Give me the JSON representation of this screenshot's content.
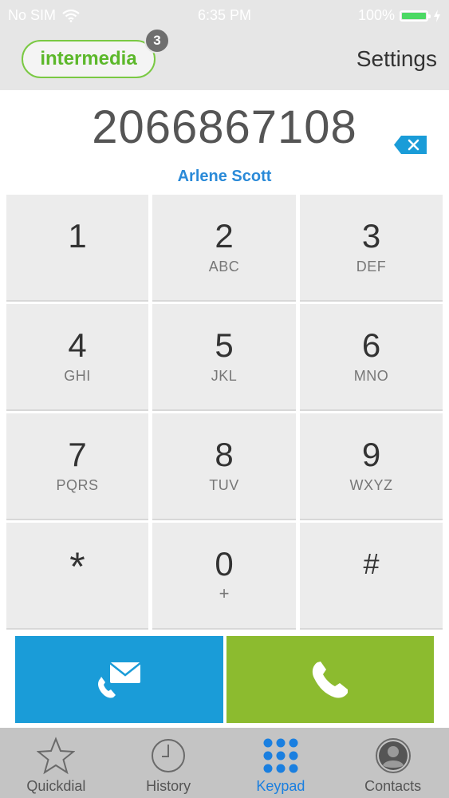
{
  "status": {
    "carrier": "No SIM",
    "time": "6:35 PM",
    "battery": "100%"
  },
  "header": {
    "logo": "intermedia",
    "badge_count": "3",
    "settings_label": "Settings"
  },
  "dialer": {
    "number": "2066867108",
    "contact_name": "Arlene Scott"
  },
  "keys": [
    {
      "digit": "1",
      "letters": ""
    },
    {
      "digit": "2",
      "letters": "ABC"
    },
    {
      "digit": "3",
      "letters": "DEF"
    },
    {
      "digit": "4",
      "letters": "GHI"
    },
    {
      "digit": "5",
      "letters": "JKL"
    },
    {
      "digit": "6",
      "letters": "MNO"
    },
    {
      "digit": "7",
      "letters": "PQRS"
    },
    {
      "digit": "8",
      "letters": "TUV"
    },
    {
      "digit": "9",
      "letters": "WXYZ"
    },
    {
      "digit": "*",
      "letters": ""
    },
    {
      "digit": "0",
      "letters": "+"
    },
    {
      "digit": "#",
      "letters": ""
    }
  ],
  "tabs": [
    {
      "label": "Quickdial",
      "icon": "star-icon"
    },
    {
      "label": "History",
      "icon": "clock-icon"
    },
    {
      "label": "Keypad",
      "icon": "keypad-icon",
      "active": true
    },
    {
      "label": "Contacts",
      "icon": "contact-icon"
    }
  ],
  "colors": {
    "brand_green": "#7ac943",
    "message_button": "#1a9cd8",
    "call_button": "#8cbb2f",
    "active_tab": "#1a7fe0",
    "contact_name": "#2a8ad8"
  }
}
